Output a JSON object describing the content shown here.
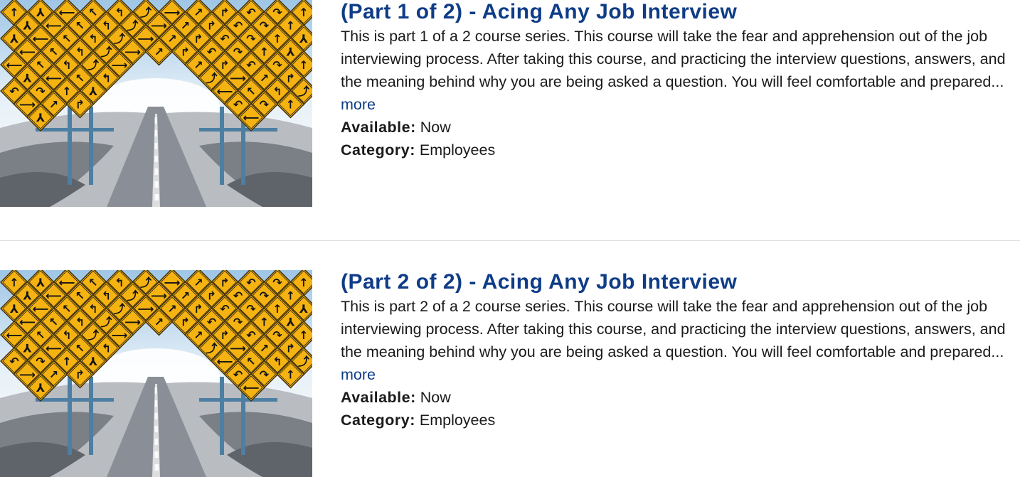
{
  "courses": [
    {
      "title": "(Part 1 of 2) - Acing Any Job Interview",
      "description": "This is part 1 of a 2 course series. This course will take the fear and apprehension out of the job interviewing process. After taking this course, and practicing the interview questions, answers, and the meaning behind why you are being asked a question. You will feel comfortable and prepared...",
      "more_label": "more",
      "available_label": "Available:",
      "available_value": "Now",
      "category_label": "Category:",
      "category_value": "Employees",
      "thumbnail_icon": "road-signs-thumbnail"
    },
    {
      "title": "(Part 2 of 2) - Acing Any Job Interview",
      "description": "This is part 2 of a 2 course series. This course will take the fear and apprehension out of the job interviewing process. After taking this course, and practicing the interview questions, answers, and the meaning behind why you are being asked a question. You will feel comfortable and prepared...",
      "more_label": "more",
      "available_label": "Available:",
      "available_value": "Now",
      "category_label": "Category:",
      "category_value": "Employees",
      "thumbnail_icon": "road-signs-thumbnail"
    }
  ],
  "colors": {
    "title": "#0f3c87",
    "link": "#0f3c87",
    "text": "#1a1a1a",
    "sign_yellow": "#f5b312",
    "sky": "#bcd7ee"
  }
}
